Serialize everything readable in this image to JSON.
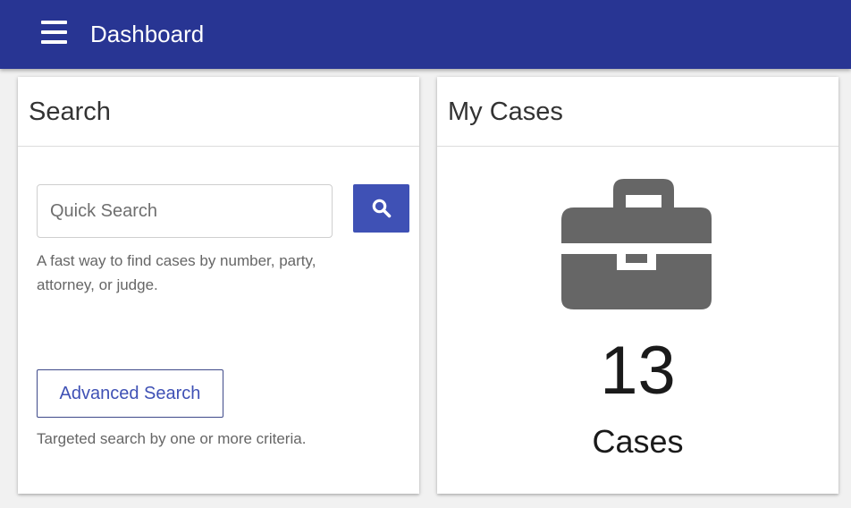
{
  "topbar": {
    "title": "Dashboard",
    "menu_icon": "hamburger-menu-icon",
    "background": "#283593"
  },
  "search_card": {
    "title": "Search",
    "quick_search_placeholder": "Quick Search",
    "search_icon": "magnifier-icon",
    "quick_help": "A fast way to find cases by number, party, attorney, or judge.",
    "advanced_label": "Advanced Search",
    "advanced_help": "Targeted search by one or more criteria.",
    "accent": "#3f51b5"
  },
  "cases_card": {
    "title": "My Cases",
    "icon": "briefcase-icon",
    "count": "13",
    "label": "Cases"
  }
}
